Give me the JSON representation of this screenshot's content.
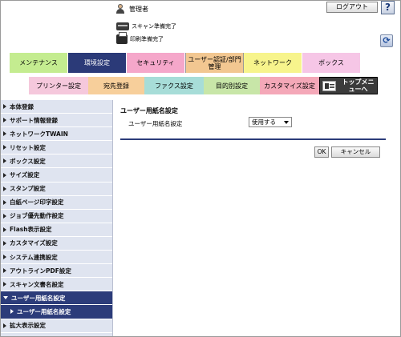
{
  "header": {
    "user_label": "管理者",
    "logout_label": "ログアウト",
    "help_label": "?",
    "scan_status": "スキャン準備完了",
    "print_status": "印刷準備完了",
    "refresh_icon": "refresh-icon"
  },
  "main_tabs": [
    {
      "label": "メンテナンス",
      "color": "#c4ec90"
    },
    {
      "label": "環境設定",
      "color": "#2b3a78",
      "active": true
    },
    {
      "label": "セキュリティ",
      "color": "#f5a7ca"
    },
    {
      "label": "ユーザー認証/部門管理",
      "color": "#f2c791"
    },
    {
      "label": "ネットワーク",
      "color": "#f7f48c"
    },
    {
      "label": "ボックス",
      "color": "#f6c6e6"
    }
  ],
  "sub_tabs": [
    {
      "label": "プリンター設定"
    },
    {
      "label": "宛先登録"
    },
    {
      "label": "ファクス設定"
    },
    {
      "label": "目的別設定"
    },
    {
      "label": "カスタマイズ設定"
    },
    {
      "label": "トップメニューへ"
    }
  ],
  "sidebar": {
    "items": [
      {
        "label": "本体登録"
      },
      {
        "label": "サポート情報登録"
      },
      {
        "label": "ネットワークTWAIN"
      },
      {
        "label": "リセット設定"
      },
      {
        "label": "ボックス設定"
      },
      {
        "label": "サイズ設定"
      },
      {
        "label": "スタンプ設定"
      },
      {
        "label": "白紙ページ印字設定"
      },
      {
        "label": "ジョブ優先動作設定"
      },
      {
        "label": "Flash表示設定"
      },
      {
        "label": "カスタマイズ設定"
      },
      {
        "label": "システム連携設定"
      },
      {
        "label": "アウトラインPDF設定"
      },
      {
        "label": "スキャン文書名設定"
      },
      {
        "label": "ユーザー用紙名設定",
        "expanded": true
      },
      {
        "label": "ユーザー用紙名設定",
        "sub": true
      },
      {
        "label": "拡大表示設定"
      }
    ]
  },
  "content": {
    "title": "ユーザー用紙名設定",
    "setting_label": "ユーザー用紙名設定",
    "setting_value": "使用する",
    "ok_label": "OK",
    "cancel_label": "キャンセル"
  }
}
